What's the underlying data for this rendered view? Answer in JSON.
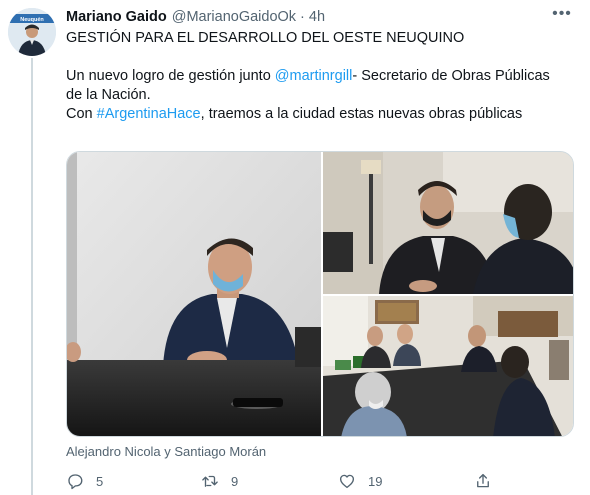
{
  "author": {
    "name": "Mariano Gaido",
    "handle": "@MarianoGaidoOk",
    "separator": "·",
    "time": "4h",
    "avatar_caption": "Neuquén"
  },
  "menu_glyph": "•••",
  "tweet": {
    "headline": "GESTIÓN PARA EL DESARROLLO DEL OESTE NEUQUINO",
    "line1_prefix": "Un nuevo logro de gestión junto ",
    "mention": "@martinrgill",
    "line1_suffix": "- Secretario de Obras Públicas",
    "line2": "de la Nación.",
    "line3_prefix": "Con ",
    "hashtag": "#ArgentinaHace",
    "line3_suffix": ", traemos a la ciudad estas nuevas obras públicas"
  },
  "tagged_people": "Alejandro Nicola y Santiago Morán",
  "actions": {
    "replies": "5",
    "retweets": "9",
    "likes": "19"
  },
  "colors": {
    "link": "#1d9bf0",
    "secondary_text": "#536471",
    "border": "#cfd9de"
  },
  "icons": [
    "more-icon",
    "reply-icon",
    "retweet-icon",
    "like-icon",
    "share-icon"
  ]
}
